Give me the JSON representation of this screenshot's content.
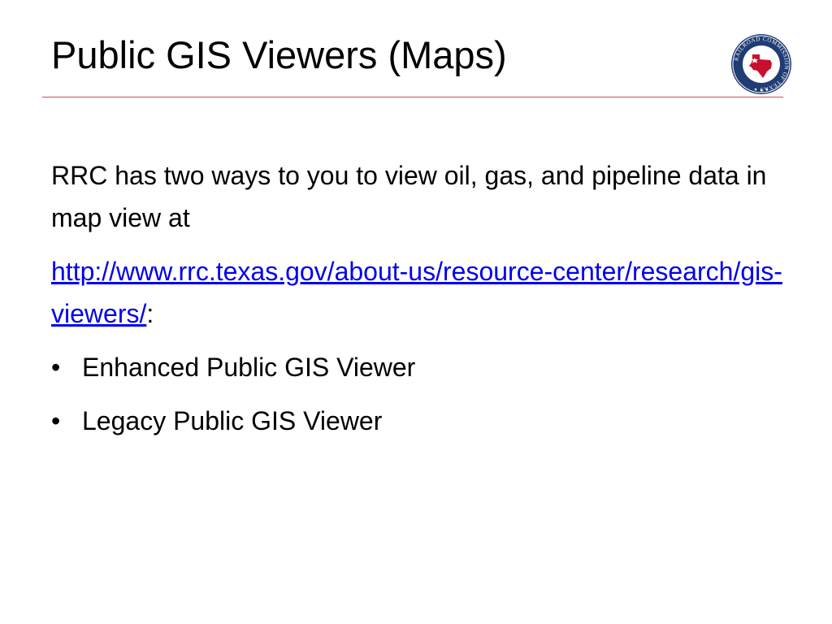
{
  "slide": {
    "title": "Public GIS Viewers (Maps)",
    "intro": "RRC has two ways to you to view oil, gas, and pipeline data in map view at",
    "link_text": "http://www.rrc.texas.gov/about-us/resource-center/research/gis-viewers/",
    "link_suffix": ":",
    "bullet_char": "•",
    "bullets": [
      "Enhanced Public GIS Viewer",
      "Legacy Public GIS Viewer"
    ]
  },
  "logo": {
    "text": "RAILROAD COMMISSION OF TEXAS",
    "icon": "texas-map-icon"
  },
  "colors": {
    "rule": "#e0483f",
    "link": "#0000ee",
    "seal_navy": "#1f3c73",
    "seal_red": "#c8102e"
  }
}
